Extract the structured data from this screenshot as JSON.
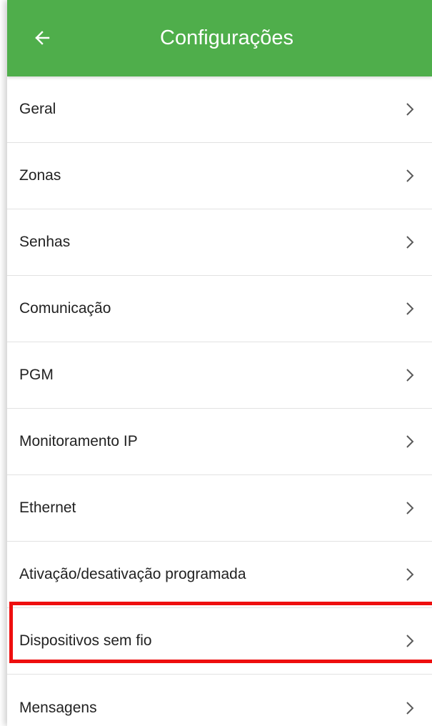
{
  "appbar": {
    "title": "Configurações",
    "back_icon": "arrow-left-icon",
    "color": "#4fae4b"
  },
  "menu": {
    "items": [
      {
        "label": "Geral"
      },
      {
        "label": "Zonas"
      },
      {
        "label": "Senhas"
      },
      {
        "label": "Comunicação"
      },
      {
        "label": "PGM"
      },
      {
        "label": "Monitoramento IP"
      },
      {
        "label": "Ethernet"
      },
      {
        "label": "Ativação/desativação programada"
      },
      {
        "label": "Dispositivos sem fio",
        "highlighted": true
      },
      {
        "label": "Mensagens"
      }
    ],
    "chevron_icon": "chevron-right-icon"
  },
  "highlight": {
    "color": "#ee0e0e"
  }
}
